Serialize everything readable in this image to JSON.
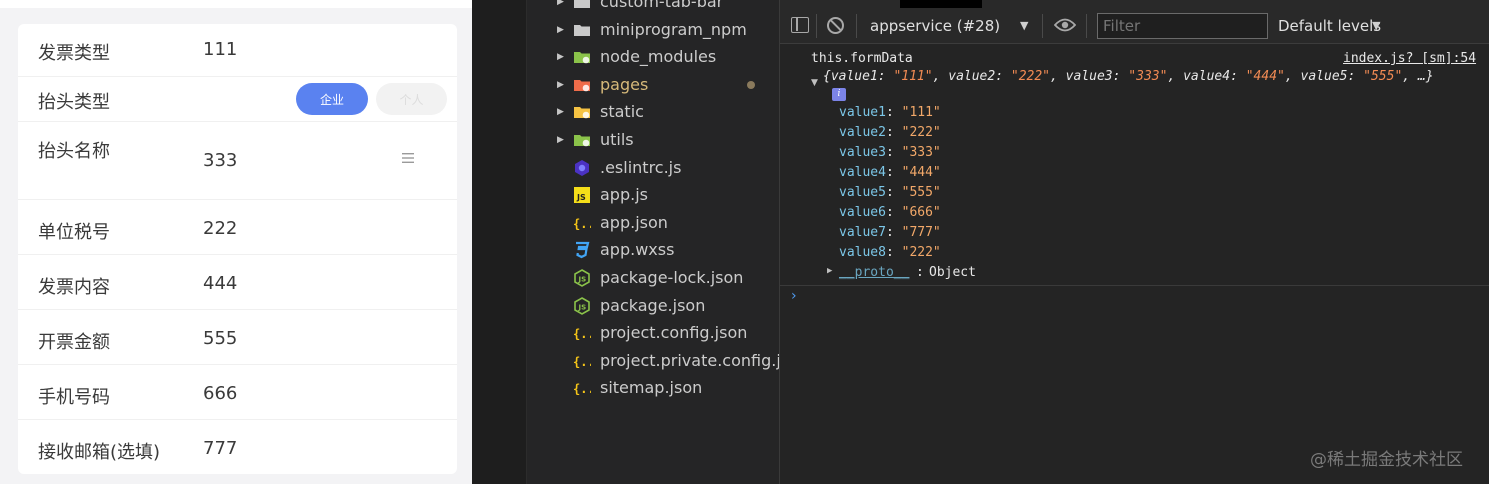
{
  "form": {
    "rows": [
      {
        "label": "发票类型",
        "value": "111"
      },
      {
        "label": "抬头类型",
        "value": ""
      },
      {
        "label": "抬头名称",
        "value": "333"
      },
      {
        "label": "单位税号",
        "value": "222"
      },
      {
        "label": "发票内容",
        "value": "444"
      },
      {
        "label": "开票金额",
        "value": "555"
      },
      {
        "label": "手机号码",
        "value": "666"
      },
      {
        "label": "接收邮箱(选填)",
        "value": "777"
      }
    ],
    "buttons": {
      "enterprise": "企业",
      "personal": "个人"
    },
    "menu_icon": "menu-lines-icon"
  },
  "explorer": {
    "items": [
      {
        "name": "custom-tab-bar",
        "type": "folder",
        "icon": "folder-icon",
        "color": "#c9c9c9"
      },
      {
        "name": "miniprogram_npm",
        "type": "folder",
        "icon": "folder-icon",
        "color": "#c9c9c9"
      },
      {
        "name": "node_modules",
        "type": "folder",
        "icon": "node-folder-icon",
        "color": "#8bc34a"
      },
      {
        "name": "pages",
        "type": "folder",
        "icon": "pages-folder-icon",
        "color": "#ef6c4a",
        "modified": true
      },
      {
        "name": "static",
        "type": "folder",
        "icon": "static-folder-icon",
        "color": "#f6c343"
      },
      {
        "name": "utils",
        "type": "folder",
        "icon": "utils-folder-icon",
        "color": "#8bc34a"
      },
      {
        "name": ".eslintrc.js",
        "type": "file",
        "icon": "eslint-icon",
        "color": "#4b32c3"
      },
      {
        "name": "app.js",
        "type": "file",
        "icon": "js-file-icon",
        "color": "#f5de19"
      },
      {
        "name": "app.json",
        "type": "file",
        "icon": "json-file-icon",
        "color": "#f5c518"
      },
      {
        "name": "app.wxss",
        "type": "file",
        "icon": "css-file-icon",
        "color": "#42a5f5"
      },
      {
        "name": "package-lock.json",
        "type": "file",
        "icon": "nodejs-file-icon",
        "color": "#8bc34a"
      },
      {
        "name": "package.json",
        "type": "file",
        "icon": "nodejs-file-icon",
        "color": "#8bc34a"
      },
      {
        "name": "project.config.json",
        "type": "file",
        "icon": "json-file-icon",
        "color": "#f5c518"
      },
      {
        "name": "project.private.config.js...",
        "type": "file",
        "icon": "json-file-icon",
        "color": "#f5c518"
      },
      {
        "name": "sitemap.json",
        "type": "file",
        "icon": "json-file-icon",
        "color": "#f5c518"
      }
    ]
  },
  "console": {
    "context": "appservice (#28)",
    "filter_placeholder": "Filter",
    "levels": "Default levels",
    "log_expression": "this.formData",
    "log_source": "index.js? [sm]:54",
    "preview": [
      {
        "key": "value1",
        "value": "\"111\""
      },
      {
        "key": "value2",
        "value": "\"222\""
      },
      {
        "key": "value3",
        "value": "\"333\""
      },
      {
        "key": "value4",
        "value": "\"444\""
      },
      {
        "key": "value5",
        "value": "\"555\""
      }
    ],
    "preview_open": "{",
    "preview_tail": ", …}",
    "info_badge": "i",
    "properties": [
      {
        "key": "value1",
        "value": "\"111\""
      },
      {
        "key": "value2",
        "value": "\"222\""
      },
      {
        "key": "value3",
        "value": "\"333\""
      },
      {
        "key": "value4",
        "value": "\"444\""
      },
      {
        "key": "value5",
        "value": "\"555\""
      },
      {
        "key": "value6",
        "value": "\"666\""
      },
      {
        "key": "value7",
        "value": "\"777\""
      },
      {
        "key": "value8",
        "value": "\"222\""
      }
    ],
    "proto_name": "__proto__",
    "proto_type": "Object",
    "prompt": "›"
  },
  "watermark": "@稀土掘金技术社区"
}
